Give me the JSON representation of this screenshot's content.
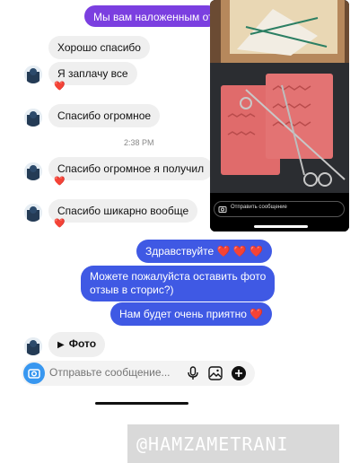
{
  "messages": {
    "top_outgoing": "Мы вам наложенным отпр",
    "incoming_1": "Хорошо спасибо",
    "incoming_2": "Я заплачу все",
    "incoming_3": "Спасибо огромное",
    "timestamp": "2:38 PM",
    "incoming_4": "Спасибо огромное я получил",
    "incoming_5": "Спасибо шикарно вообще",
    "outgoing_1": "Здравствуйте ❤️ ❤️ ❤️",
    "outgoing_2_line1": "Можете пожалуйста оставить фото",
    "outgoing_2_line2": "отзыв в сторис?)",
    "outgoing_3": "Нам будет очень приятно ❤️",
    "incoming_audio": "Фото",
    "reaction": "❤️"
  },
  "story_overlay": {
    "reply_placeholder": "Отправить сообщение"
  },
  "composer": {
    "placeholder": "Отправьте сообщение..."
  },
  "watermark": {
    "text": "@HAMZAMETRANI"
  },
  "colors": {
    "outgoing_bubble": "#3f59e4",
    "incoming_bubble": "#efefef",
    "camera_button": "#3897f0"
  }
}
